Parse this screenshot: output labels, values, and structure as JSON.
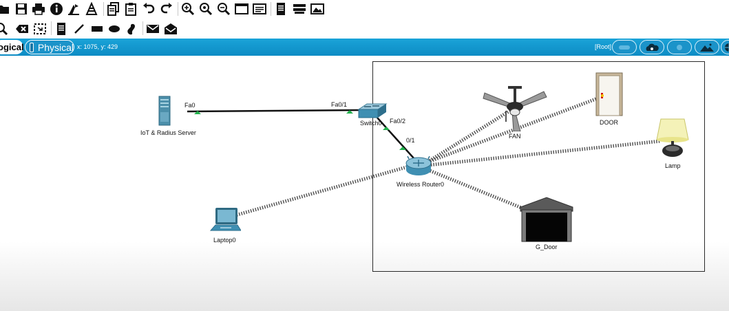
{
  "toolbar1": {
    "icons": [
      "open-folder-icon",
      "save-icon",
      "print-icon",
      "info-icon",
      "activity-wizard-icon",
      "custom-devices-icon",
      "copy-icon",
      "paste-icon",
      "undo-icon",
      "redo-icon",
      "zoom-in-icon",
      "zoom-reset-icon",
      "zoom-out-icon",
      "drawing-palette-icon",
      "custom-device-dialog-icon",
      "viewport-icon",
      "cluster-icon",
      "background-image-icon"
    ]
  },
  "toolbar2": {
    "icons": [
      "inspect-icon",
      "delete-icon",
      "resize-icon",
      "note-icon",
      "line-icon",
      "rectangle-icon",
      "ellipse-icon",
      "freeform-icon",
      "simple-pdu-icon",
      "complex-pdu-icon"
    ]
  },
  "modebar": {
    "logical_tab": "ogical",
    "physical_tab": "Physical",
    "coords": "x: 1075, y: 429",
    "root_label": "[Root]",
    "right_buttons": [
      "navigation-icon",
      "cloud-icon",
      "cluster-icon",
      "mountain-icon",
      "globe-icon"
    ]
  },
  "devices": {
    "server": {
      "label": "IoT & Radius Server"
    },
    "switch": {
      "label": "Switch0"
    },
    "router": {
      "label": "Wireless Router0"
    },
    "laptop": {
      "label": "Laptop0"
    },
    "fan": {
      "label": "FAN"
    },
    "door": {
      "label": "DOOR"
    },
    "lamp": {
      "label": "Lamp"
    },
    "garage": {
      "label": "G_Door"
    }
  },
  "ports": {
    "server_fa0": "Fa0",
    "switch_fa01": "Fa0/1",
    "switch_fa02": "Fa0/2",
    "router_01": "0/1"
  },
  "colors": {
    "modebar": "#1aa3d8",
    "link_up": "#22b14c",
    "cable": "#111111"
  }
}
